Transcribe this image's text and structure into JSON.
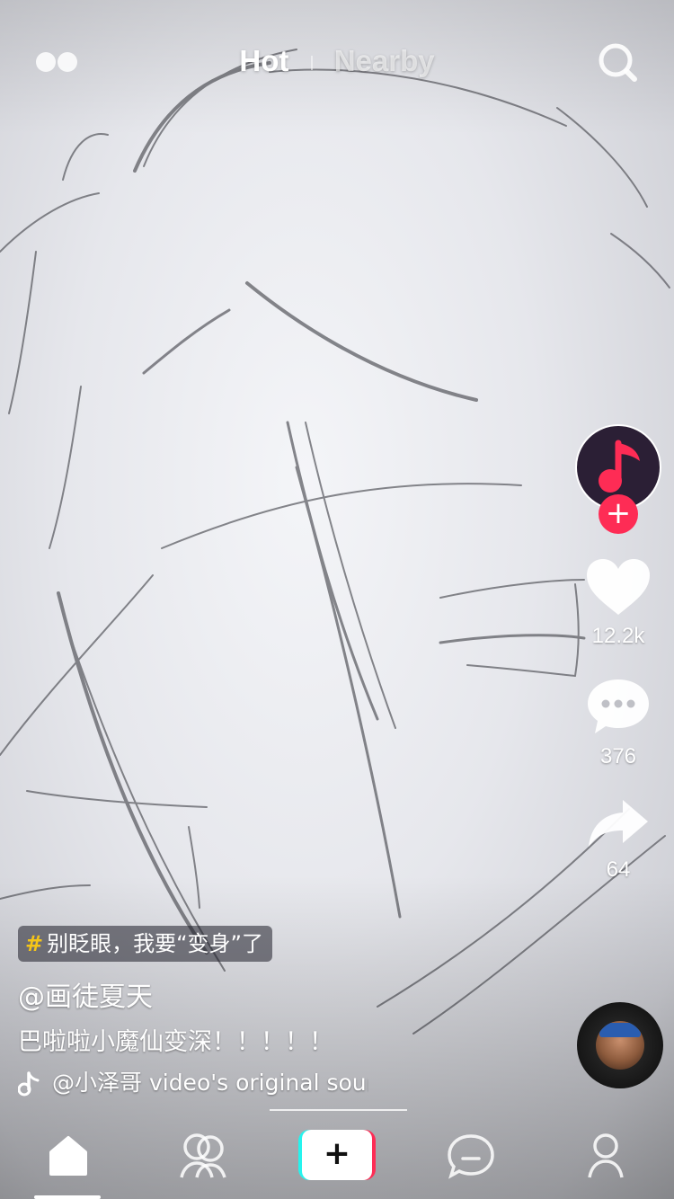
{
  "top_nav": {
    "tabs": [
      {
        "label": "Hot",
        "active": true
      },
      {
        "label": "Nearby",
        "active": false
      }
    ],
    "left_icon": "live-dots-icon",
    "right_icon": "search-icon"
  },
  "right_rail": {
    "creator_avatar_icon": "music-note-icon",
    "follow_label": "+",
    "like_count": "12.2k",
    "comment_count": "376",
    "share_count": "64"
  },
  "caption": {
    "hashtag": "别眨眼，我要“变身”了",
    "username": "@画徒夏天",
    "description": "巴啦啦小魔仙变深！！！！！",
    "music": "@小泽哥 video's original sound"
  },
  "tab_bar": {
    "items": [
      "home-icon",
      "friends-icon",
      "create-button",
      "inbox-icon",
      "profile-icon"
    ],
    "create_label": "+"
  },
  "colors": {
    "accent_red": "#fe2c55",
    "accent_cyan": "#25f4ee",
    "hashtag_yellow": "#f5c518"
  }
}
